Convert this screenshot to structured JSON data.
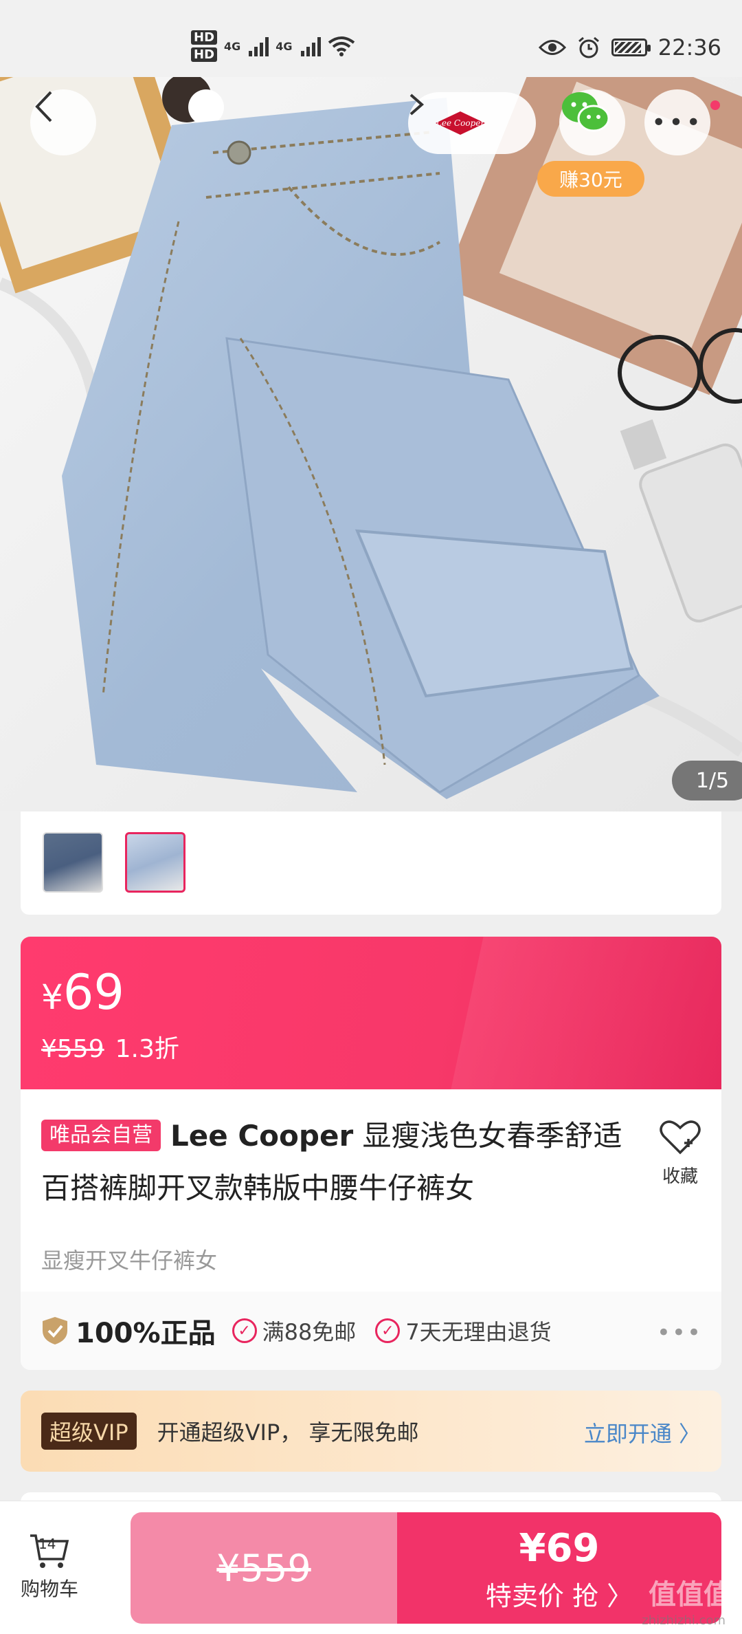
{
  "status_bar": {
    "hd1": "HD",
    "hd2": "HD",
    "net1": "4G",
    "net2": "4G",
    "time": "22:36"
  },
  "hero": {
    "page_indicator": "1/5",
    "earn_badge": "赚30元",
    "brand_logo_text": "Lee Cooper"
  },
  "price": {
    "current": "69",
    "currency": "¥",
    "original": "¥559",
    "discount": "1.3折"
  },
  "product": {
    "tag": "唯品会自营",
    "brand": "Lee Cooper",
    "title": " 显瘦浅色女春季舒适百搭裤脚开叉款韩版中腰牛仔裤女",
    "subtitle": "显瘦开叉牛仔裤女",
    "favorite_label": "收藏"
  },
  "guarantees": {
    "genuine": "100%正品",
    "items": [
      "满88免邮",
      "7天无理由退货"
    ],
    "more": "•••"
  },
  "vip": {
    "badge": "超级VIP",
    "text": "开通超级VIP， 享无限免邮",
    "cta": "立即开通 〉"
  },
  "bottom": {
    "cart_count": "14",
    "cart_label": "购物车",
    "original_price": "¥559",
    "sale_price": "¥69",
    "sale_label": "特卖价 抢 〉"
  },
  "watermark": {
    "main": "值值值",
    "sub": "zhizhizhi.com"
  },
  "colors": {
    "accent": "#f23369",
    "vip_dark": "#4a2a18",
    "link": "#4a87c8"
  }
}
